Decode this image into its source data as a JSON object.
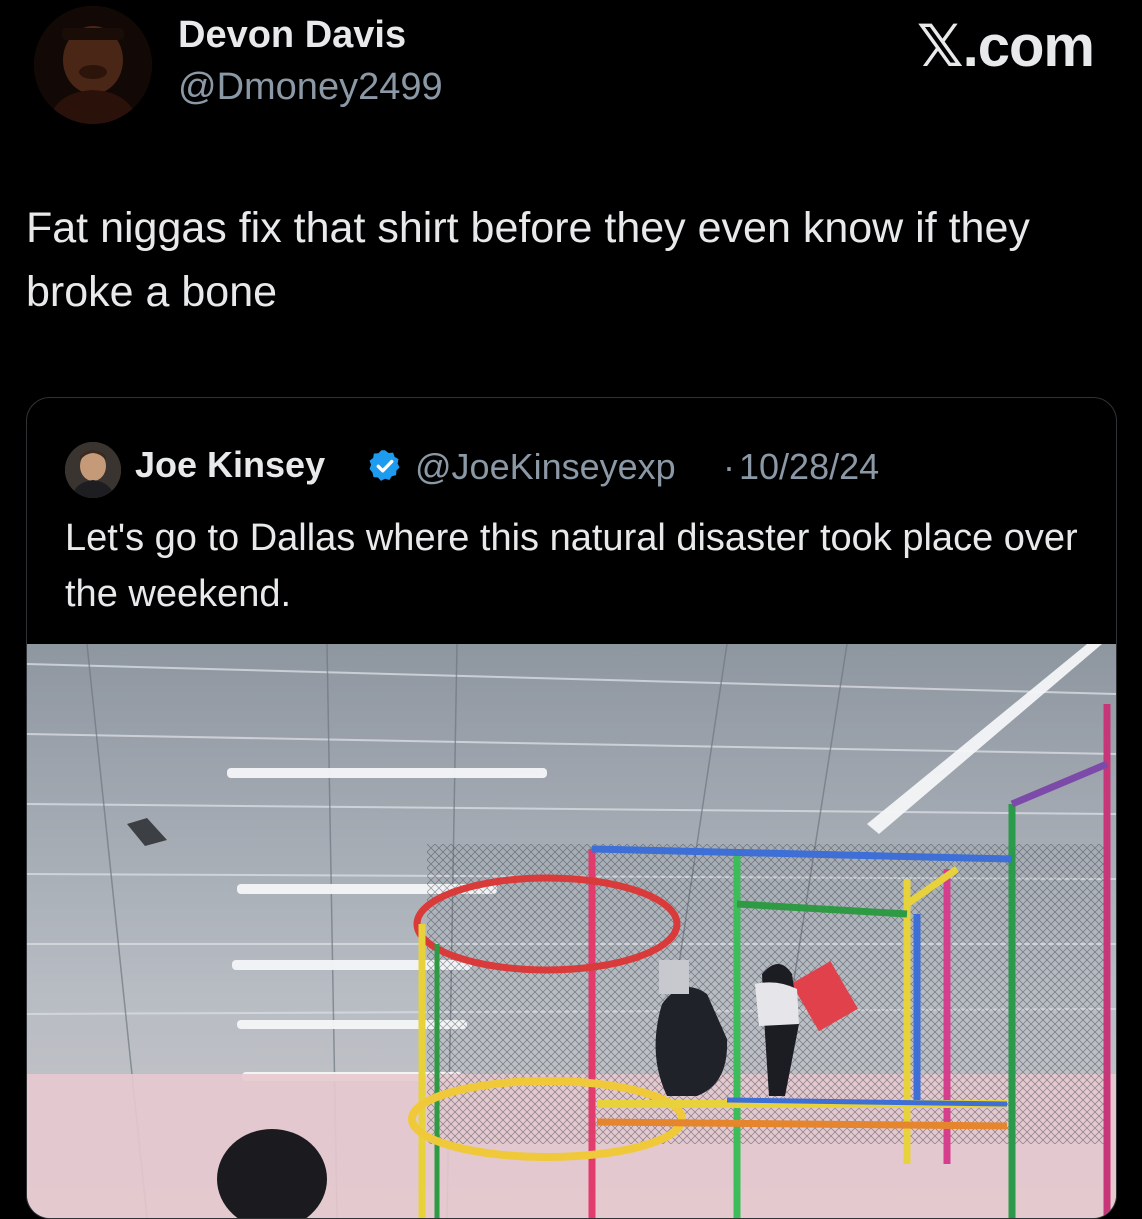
{
  "post": {
    "author": {
      "name": "Devon Davis",
      "handle": "@Dmoney2499",
      "avatar_icon": "user-avatar-photo"
    },
    "brand_label": "𝕏.com",
    "text": "Fat niggas fix that shirt before they even know if they broke a bone"
  },
  "quote": {
    "author": {
      "name": "Joe Kinsey",
      "handle": "@JoeKinseyexp",
      "avatar_icon": "user-avatar-photo",
      "verified_icon": "verified-badge-icon"
    },
    "separator": "·",
    "date": "10/28/24",
    "text": "Let's go to Dallas where this natural disaster took place over the weekend.",
    "media": {
      "type": "photo",
      "icon": "indoor-playground-photo"
    }
  },
  "colors": {
    "background": "#000000",
    "primary_text": "#e7e9ea",
    "secondary_text": "#8b98a5",
    "border": "#2f3336",
    "verified_blue": "#1d9bf0"
  }
}
